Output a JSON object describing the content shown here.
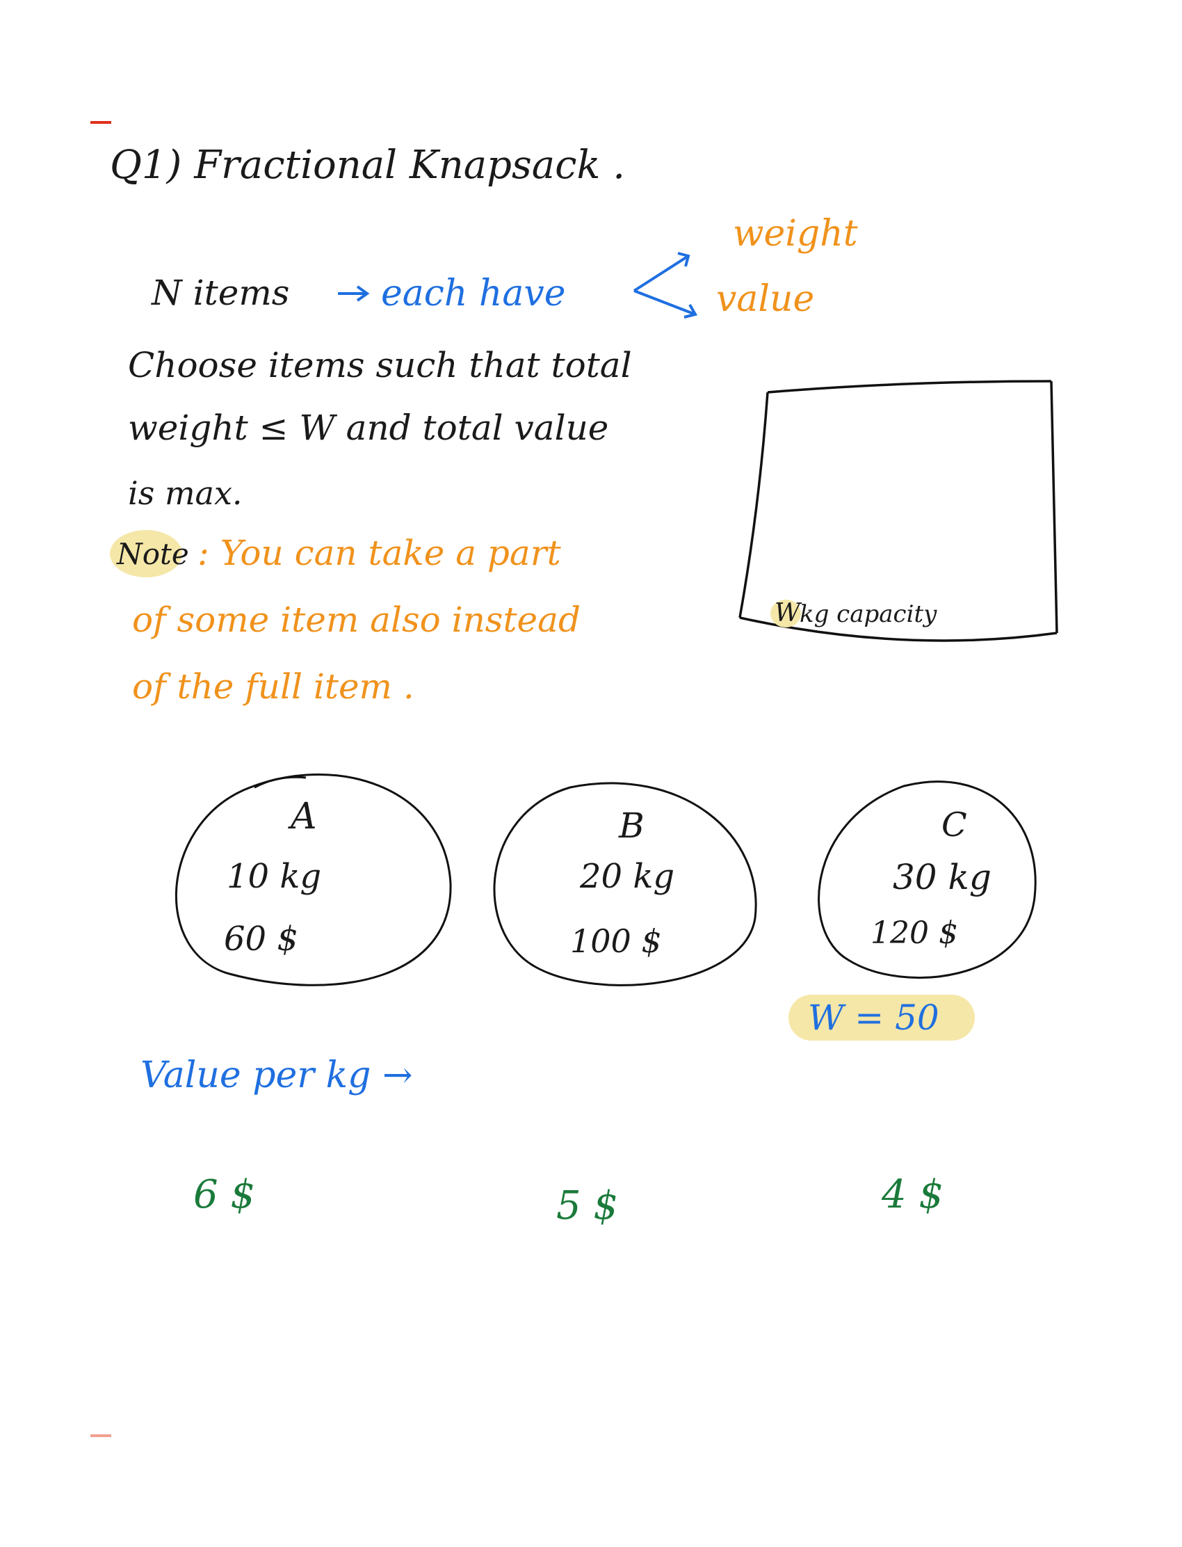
{
  "title": "Q1) Fractional Knapsack .",
  "intro": {
    "n_items": "N items",
    "each_have": "each have",
    "weight": "weight",
    "value": "value"
  },
  "problem": {
    "line1": "Choose items such that total",
    "line2": "weight ≤ W and total value",
    "line3": "is max."
  },
  "note": {
    "label": "Note",
    "line1": ": You can take a part",
    "line2": "of some item also instead",
    "line3": "of the full item ."
  },
  "knapsack": {
    "caption_w": "W",
    "caption_rest": "kg capacity"
  },
  "items": [
    {
      "name": "A",
      "weight": "10 kg",
      "value": "60 $"
    },
    {
      "name": "B",
      "weight": "20 kg",
      "value": "100 $"
    },
    {
      "name": "C",
      "weight": "30 kg",
      "value": "120 $"
    }
  ],
  "capacity_label": "W = 50",
  "value_per_kg_label": "Value per kg →",
  "value_per_kg": [
    "6 $",
    "5 $",
    "4 $"
  ],
  "colors": {
    "black": "#1a1a1a",
    "blue": "#1f6fe0",
    "orange": "#f0921c",
    "green": "#1a7a3a",
    "highlight": "#f5e7a8",
    "red_mark": "#e0301e"
  }
}
